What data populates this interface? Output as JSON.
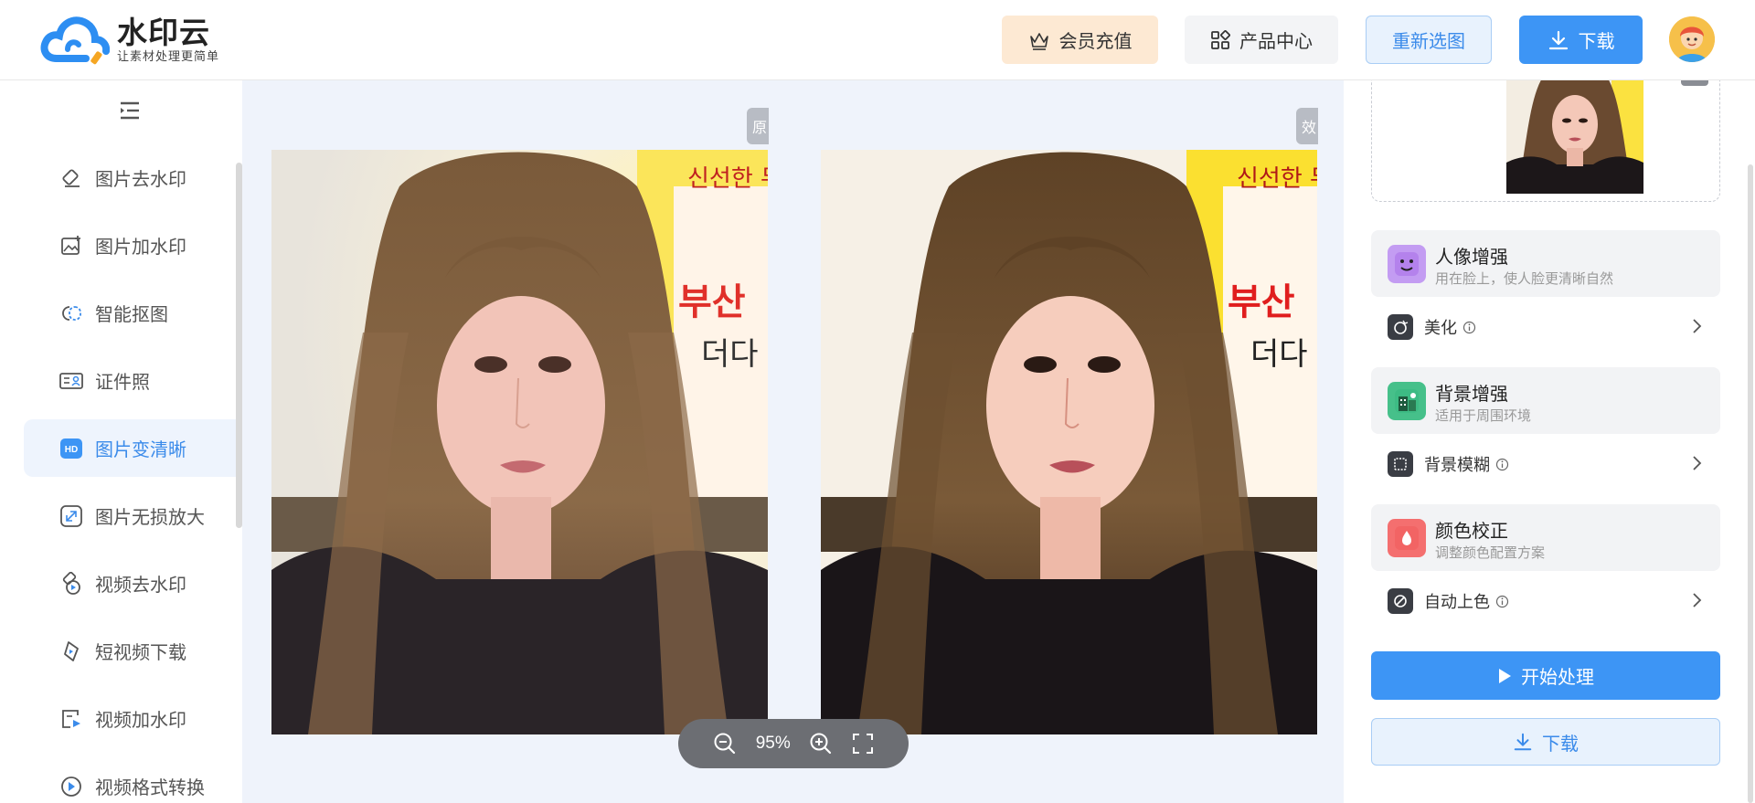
{
  "header": {
    "logo_title": "水印云",
    "logo_subtitle": "让素材处理更简单",
    "vip_label": "会员充值",
    "product_label": "产品中心",
    "reselect_label": "重新选图",
    "download_label": "下载"
  },
  "sidebar": {
    "items": [
      {
        "label": "图片去水印",
        "icon": "eraser-icon"
      },
      {
        "label": "图片加水印",
        "icon": "image-add-icon"
      },
      {
        "label": "智能抠图",
        "icon": "cutout-icon"
      },
      {
        "label": "证件照",
        "icon": "id-card-icon"
      },
      {
        "label": "图片变清晰",
        "icon": "hd-icon",
        "active": true
      },
      {
        "label": "图片无损放大",
        "icon": "enlarge-icon"
      },
      {
        "label": "视频去水印",
        "icon": "video-eraser-icon"
      },
      {
        "label": "短视频下载",
        "icon": "short-video-download-icon"
      },
      {
        "label": "视频加水印",
        "icon": "video-add-icon"
      },
      {
        "label": "视频格式转换",
        "icon": "video-convert-icon"
      }
    ]
  },
  "canvas": {
    "zoom": "95%",
    "left_tag": "原",
    "right_tag": "效"
  },
  "panel": {
    "features": [
      {
        "title": "人像增强",
        "desc": "用在脸上，使人脸更清晰自然",
        "color": "#c39cf2",
        "option": "美化"
      },
      {
        "title": "背景增强",
        "desc": "适用于周围环境",
        "color": "#46c08a",
        "option": "背景模糊"
      },
      {
        "title": "颜色校正",
        "desc": "调整颜色配置方案",
        "color": "#f46f6f",
        "option": "自动上色"
      }
    ],
    "start_label": "开始处理",
    "download_label": "下载"
  },
  "colors": {
    "accent": "#3d95f5",
    "vip_bg": "#fde9d3",
    "canvas_bg": "#eff3fb"
  }
}
